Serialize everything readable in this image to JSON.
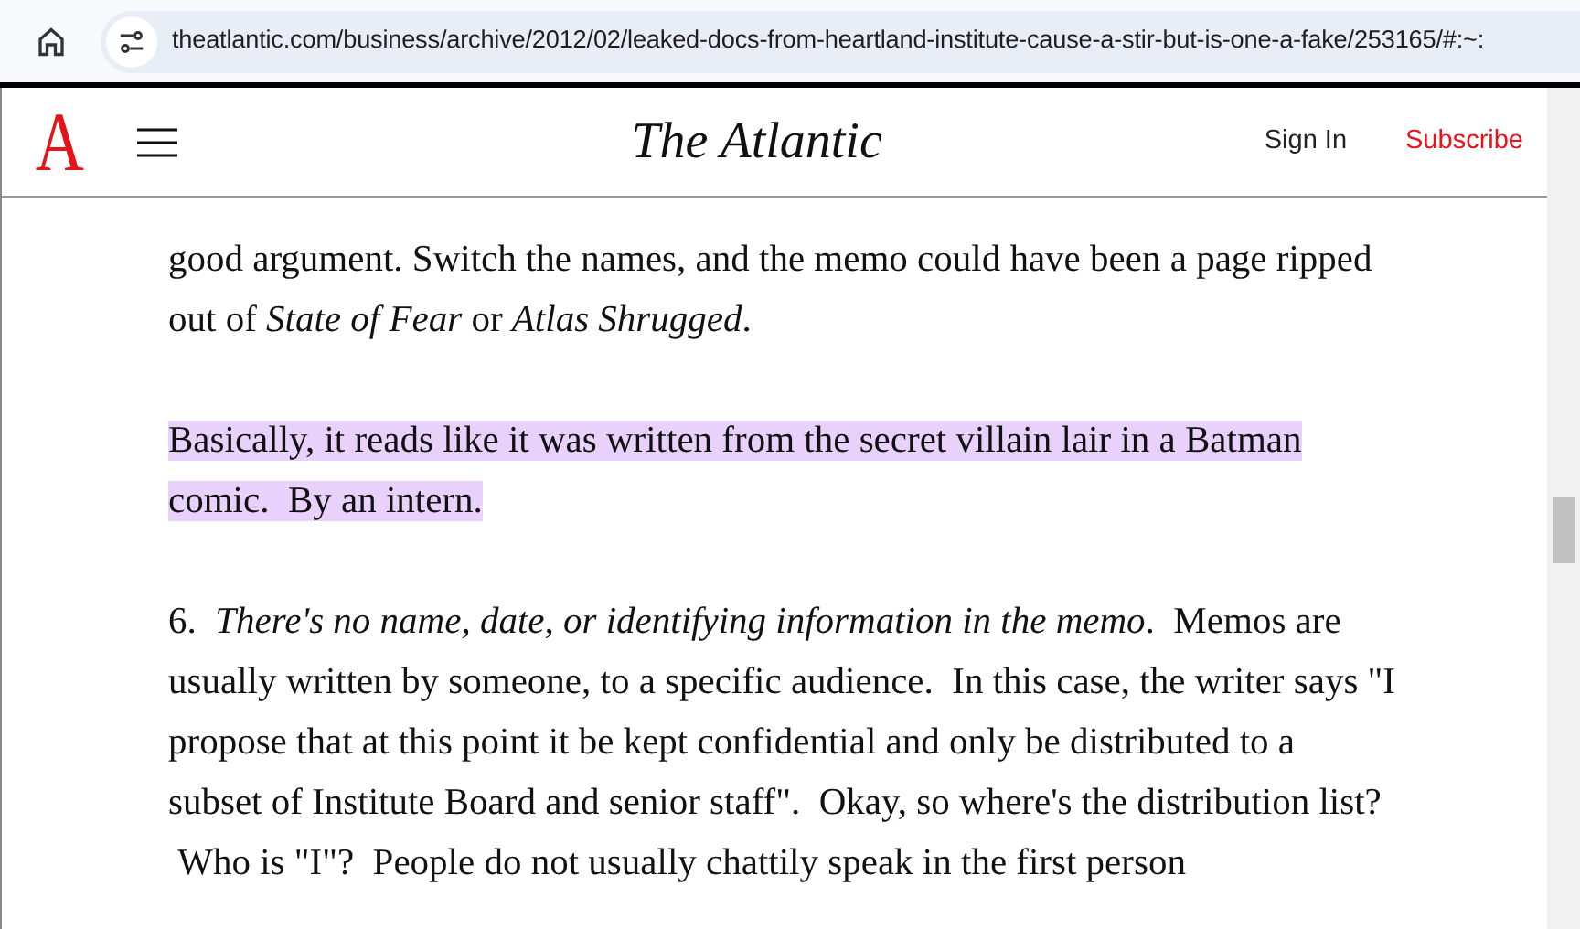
{
  "browser": {
    "url": "theatlantic.com/business/archive/2012/02/leaked-docs-from-heartland-institute-cause-a-stir-but-is-one-a-fake/253165/#:~:"
  },
  "header": {
    "logo_letter": "A",
    "title": "The Atlantic",
    "sign_in": "Sign In",
    "subscribe": "Subscribe"
  },
  "article": {
    "paragraphs": [
      {
        "text": "good argument. Switch the names, and the memo could have been a page ripped out of *State of Fear* or *Atlas Shrugged*.",
        "highlighted": false
      },
      {
        "text": "Basically, it reads like it was written from the secret villain lair in a Batman comic.  By an intern.",
        "highlighted": true
      },
      {
        "text": "6.  *There's no name, date, or identifying information in the memo*.  Memos are usually written by someone, to a specific audience.  In this case, the writer says \"I propose that at this point it be kept confidential and only be distributed to a subset of Institute Board and senior staff\".  Okay, so where's the distribution list?  Who is \"I\"?  People do not usually chattily speak in the first person",
        "highlighted": false
      }
    ]
  }
}
